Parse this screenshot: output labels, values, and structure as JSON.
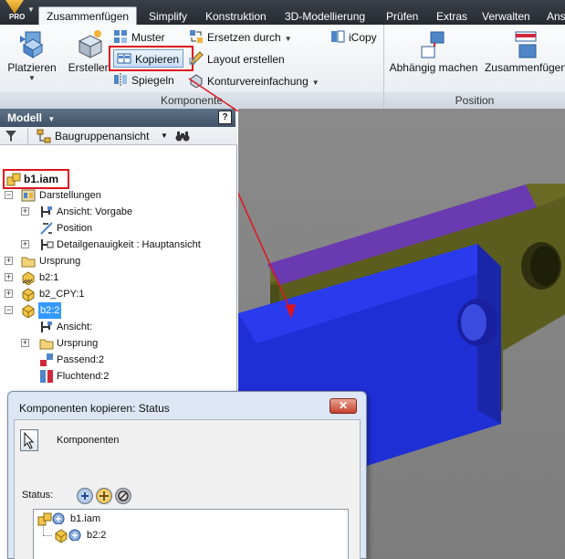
{
  "app": {
    "badge": "PRO"
  },
  "tabs": [
    {
      "label": "Zusammenfügen",
      "active": true
    },
    {
      "label": "Simplify"
    },
    {
      "label": "Konstruktion"
    },
    {
      "label": "3D-Modellierung"
    },
    {
      "label": "Prüfen"
    },
    {
      "label": "Extras"
    },
    {
      "label": "Verwalten"
    },
    {
      "label": "Ans"
    }
  ],
  "ribbon": {
    "platzieren": "Platzieren",
    "erstellen": "Erstellen",
    "muster": "Muster",
    "kopieren": "Kopieren",
    "spiegeln": "Spiegeln",
    "ersetzen": "Ersetzen durch",
    "layout": "Layout erstellen",
    "kontur": "Konturvereinfachung",
    "icopy": "iCopy",
    "abhaengig": "Abhängig machen",
    "zusammenfuegen": "Zusammenfügen",
    "panel_komponente": "Komponente",
    "panel_position": "Position"
  },
  "browser": {
    "title": "Modell",
    "view_mode": "Baugruppenansicht",
    "tree": [
      {
        "label": "b1.iam",
        "depth": 0,
        "bold": true
      },
      {
        "label": "Darstellungen",
        "depth": 1
      },
      {
        "label": "Ansicht: Vorgabe",
        "depth": 2
      },
      {
        "label": "Position",
        "depth": 2
      },
      {
        "label": "Detailgenauigkeit : Hauptansicht",
        "depth": 2
      },
      {
        "label": "Ursprung",
        "depth": 1
      },
      {
        "label": "b2:1",
        "depth": 1
      },
      {
        "label": "b2_CPY:1",
        "depth": 1
      },
      {
        "label": "b2:2",
        "depth": 1,
        "selected": true
      },
      {
        "label": "Ansicht:",
        "depth": 2
      },
      {
        "label": "Ursprung",
        "depth": 2
      },
      {
        "label": "Passend:2",
        "depth": 2
      },
      {
        "label": "Fluchtend:2",
        "depth": 2
      }
    ]
  },
  "dialog": {
    "title": "Komponenten kopieren: Status",
    "components_label": "Komponenten",
    "status_label": "Status:",
    "list": [
      {
        "label": "b1.iam"
      },
      {
        "label": "b2:2"
      }
    ]
  },
  "colors": {
    "part_blue": "#1f2fd6",
    "part_olive": "#5b5d1f",
    "part_purple": "#6a3bb0",
    "highlight_red": "#e0141c"
  }
}
